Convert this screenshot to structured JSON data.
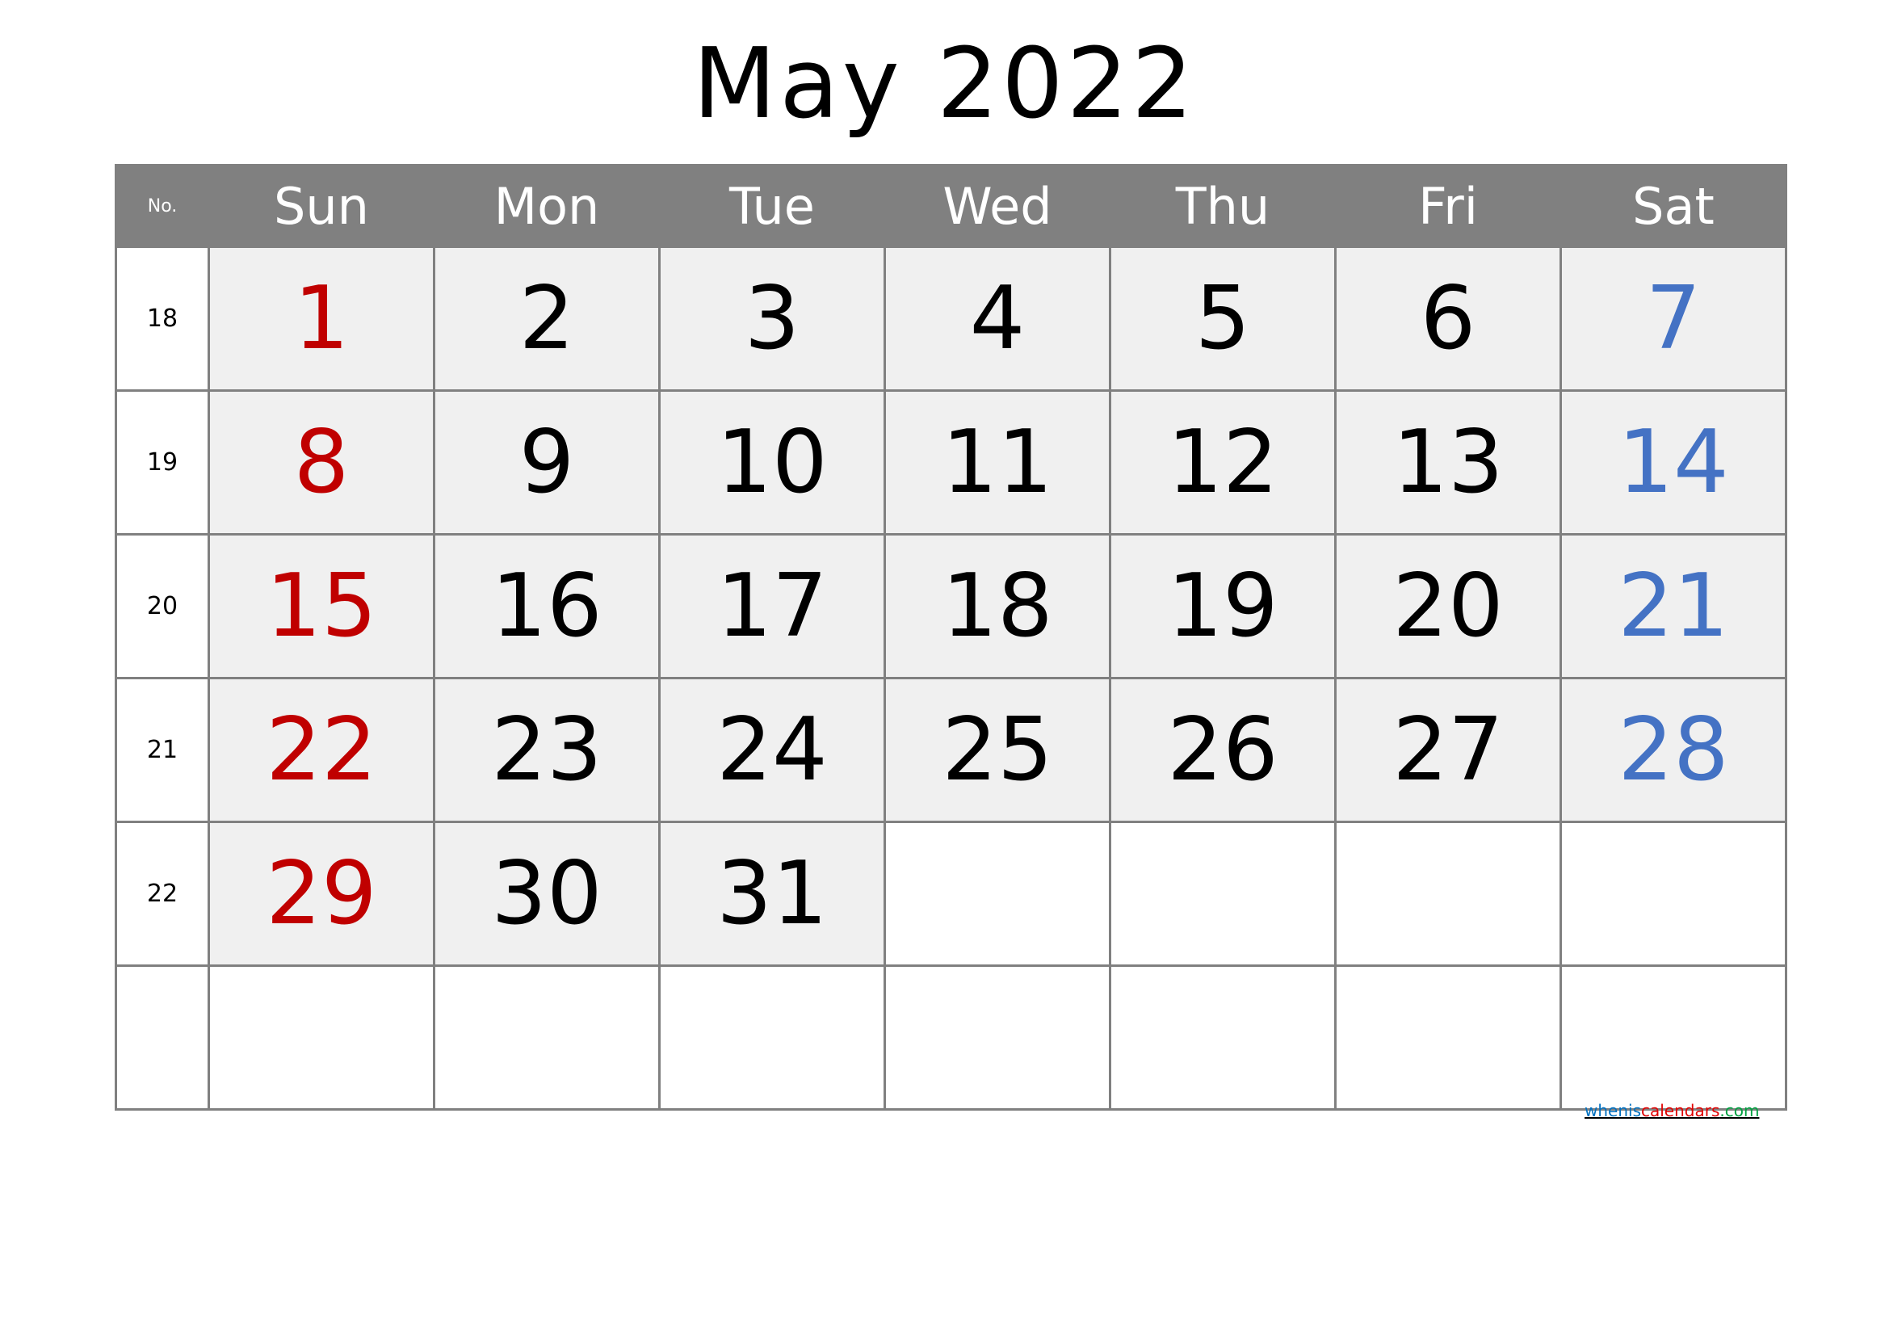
{
  "title": "May 2022",
  "header": {
    "no_label": "No.",
    "days": [
      "Sun",
      "Mon",
      "Tue",
      "Wed",
      "Thu",
      "Fri",
      "Sat"
    ]
  },
  "weeks": [
    {
      "no": "18",
      "days": [
        "1",
        "2",
        "3",
        "4",
        "5",
        "6",
        "7"
      ]
    },
    {
      "no": "19",
      "days": [
        "8",
        "9",
        "10",
        "11",
        "12",
        "13",
        "14"
      ]
    },
    {
      "no": "20",
      "days": [
        "15",
        "16",
        "17",
        "18",
        "19",
        "20",
        "21"
      ]
    },
    {
      "no": "21",
      "days": [
        "22",
        "23",
        "24",
        "25",
        "26",
        "27",
        "28"
      ]
    },
    {
      "no": "22",
      "days": [
        "29",
        "30",
        "31",
        "",
        "",
        "",
        ""
      ]
    },
    {
      "no": "",
      "days": [
        "",
        "",
        "",
        "",
        "",
        "",
        ""
      ]
    }
  ],
  "colors": {
    "sunday": "#c00000",
    "saturday": "#4472c4",
    "weekday": "#000000",
    "header_bg": "#808080",
    "cell_bg": "#f0f0f0"
  },
  "brand": {
    "part1": "whenis",
    "part2": "calendars",
    "part3": ".com"
  }
}
